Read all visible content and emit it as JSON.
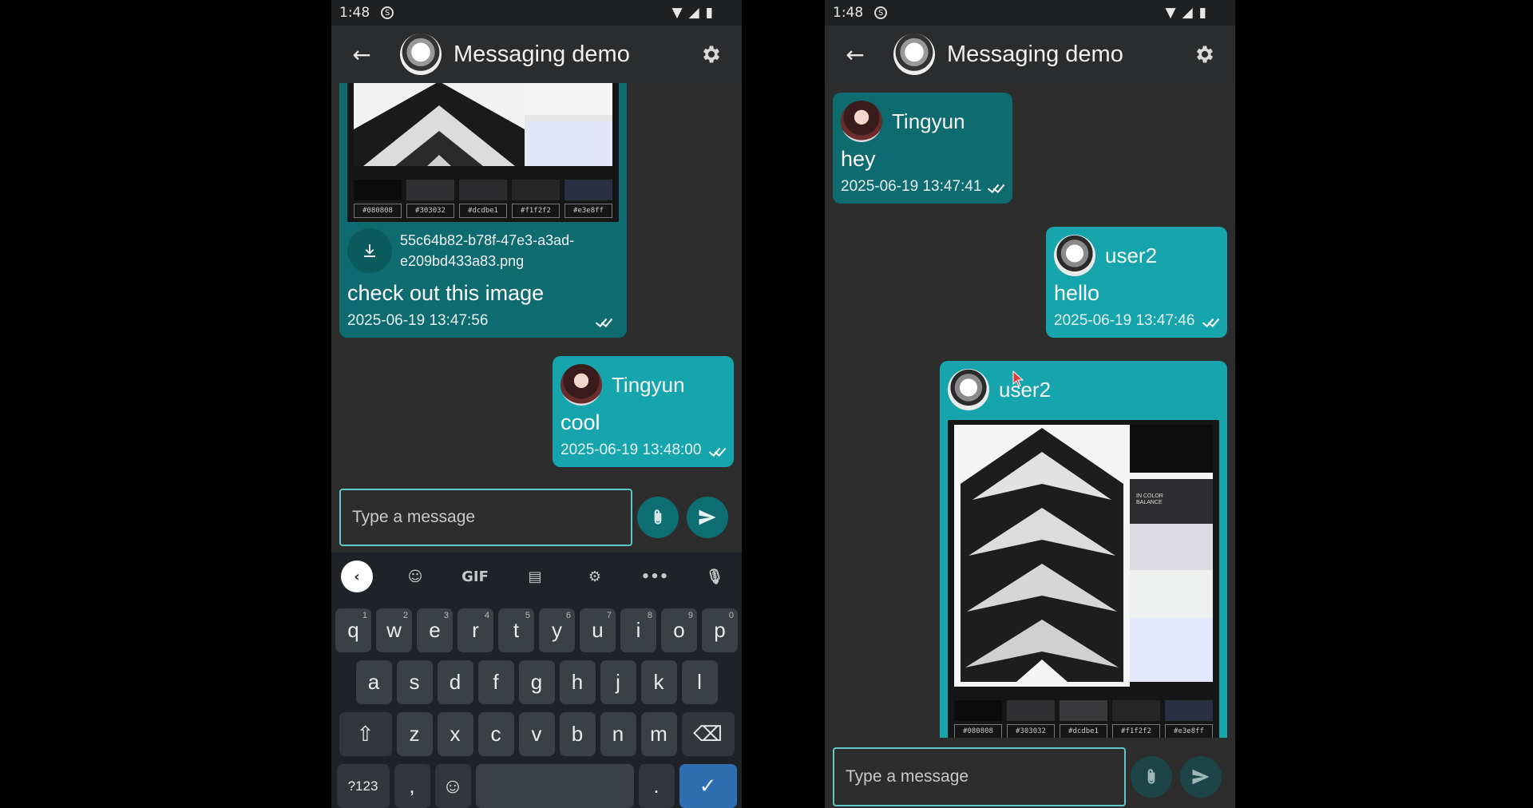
{
  "left": {
    "status": {
      "time": "1:48"
    },
    "appbar": {
      "title": "Messaging demo"
    },
    "image_msg": {
      "swatches": [
        {
          "label": "#080808",
          "color": "#080808"
        },
        {
          "label": "#303032",
          "color": "#303032"
        },
        {
          "label": "#dcdbe1",
          "color": "#1b1b1d"
        },
        {
          "label": "#f1f2f2",
          "color": "#1f1f20"
        },
        {
          "label": "#e3e8ff",
          "color": "#2b2f44"
        }
      ],
      "filename": "55c64b82-b78f-47e3-a3ad-e209bd433a83.png",
      "text": "check out this image",
      "timestamp": "2025-06-19 13:47:56"
    },
    "cool_msg": {
      "sender": "Tingyun",
      "text": "cool",
      "timestamp": "2025-06-19 13:48:00"
    },
    "composer": {
      "placeholder": "Type a message"
    },
    "keyboard": {
      "toolbar": {
        "gif": "GIF"
      },
      "row1": [
        [
          "q",
          "1"
        ],
        [
          "w",
          "2"
        ],
        [
          "e",
          "3"
        ],
        [
          "r",
          "4"
        ],
        [
          "t",
          "5"
        ],
        [
          "y",
          "6"
        ],
        [
          "u",
          "7"
        ],
        [
          "i",
          "8"
        ],
        [
          "o",
          "9"
        ],
        [
          "p",
          "0"
        ]
      ],
      "row2": [
        "a",
        "s",
        "d",
        "f",
        "g",
        "h",
        "j",
        "k",
        "l"
      ],
      "row3": [
        "z",
        "x",
        "c",
        "v",
        "b",
        "n",
        "m"
      ],
      "sym_key": "?123",
      "comma": ",",
      "period": "."
    }
  },
  "right": {
    "status": {
      "time": "1:48"
    },
    "appbar": {
      "title": "Messaging demo"
    },
    "msg1": {
      "sender": "Tingyun",
      "text": "hey",
      "timestamp": "2025-06-19 13:47:41"
    },
    "msg2": {
      "sender": "user2",
      "text": "hello",
      "timestamp": "2025-06-19 13:47:46"
    },
    "msg3": {
      "sender": "user2",
      "poster_text": "IN COLOR BALANCE",
      "swatches": [
        {
          "label": "#080808",
          "color": "#080808"
        },
        {
          "label": "#303032",
          "color": "#303032"
        },
        {
          "label": "#dcdbe1",
          "color": "#3a3a3c"
        },
        {
          "label": "#f1f2f2",
          "color": "#1f1f20"
        },
        {
          "label": "#e3e8ff",
          "color": "#2b2f44"
        }
      ]
    },
    "composer": {
      "placeholder": "Type a message"
    }
  }
}
